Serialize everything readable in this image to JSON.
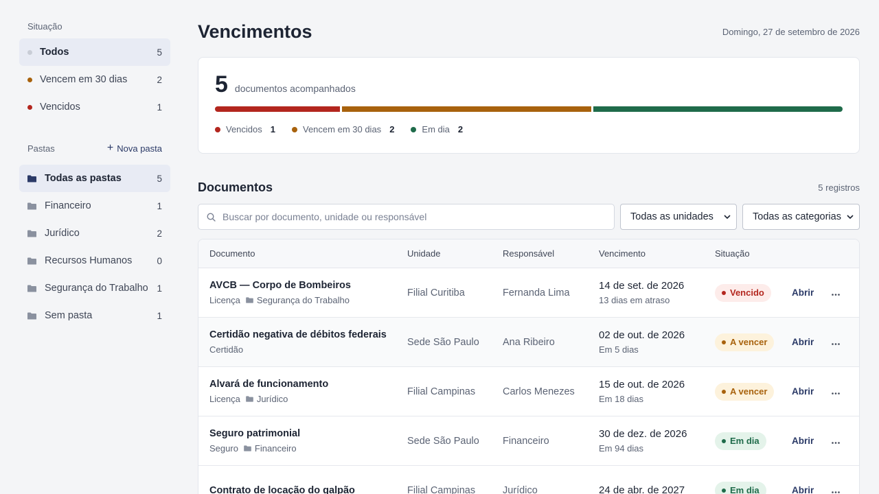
{
  "colors": {
    "overdue": "#b3261e",
    "due_soon": "#a8620d",
    "on_time": "#1f6b4a",
    "neutral": "#c9cdd6",
    "folder": "#8a919f",
    "folder_active": "#2b3a67"
  },
  "sidebar": {
    "status_label": "Situação",
    "status_items": [
      {
        "label": "Todos",
        "count": "5",
        "dot": "#c9cdd6"
      },
      {
        "label": "Vencem em 30 dias",
        "count": "2",
        "dot": "#a8620d"
      },
      {
        "label": "Vencidos",
        "count": "1",
        "dot": "#b3261e"
      }
    ],
    "folders_label": "Pastas",
    "new_folder_label": "Nova pasta",
    "folder_items": [
      {
        "label": "Todas as pastas",
        "count": "5"
      },
      {
        "label": "Financeiro",
        "count": "1"
      },
      {
        "label": "Jurídico",
        "count": "2"
      },
      {
        "label": "Recursos Humanos",
        "count": "0"
      },
      {
        "label": "Segurança do Trabalho",
        "count": "1"
      },
      {
        "label": "Sem pasta",
        "count": "1"
      }
    ]
  },
  "header": {
    "title": "Vencimentos",
    "date": "Domingo, 27 de setembro de 2026"
  },
  "summary": {
    "total": "5",
    "total_label": "documentos acompanhados",
    "breakdown": [
      {
        "label": "Vencidos",
        "value": 1,
        "count": "1",
        "color": "#b3261e"
      },
      {
        "label": "Vencem em 30 dias",
        "value": 2,
        "count": "2",
        "color": "#a8620d"
      },
      {
        "label": "Em dia",
        "value": 2,
        "count": "2",
        "color": "#1f6b4a"
      }
    ]
  },
  "documents": {
    "title": "Documentos",
    "records": "5 registros",
    "search_placeholder": "Buscar por documento, unidade ou responsável",
    "unit_filter": "Todas as unidades",
    "category_filter": "Todas as categorias",
    "columns": [
      "Documento",
      "Unidade",
      "Responsável",
      "Vencimento",
      "Situação"
    ],
    "open_label": "Abrir",
    "rows": [
      {
        "name": "AVCB — Corpo de Bombeiros",
        "type": "Licença",
        "folder": "Segurança do Trabalho",
        "unit": "Filial Curitiba",
        "resp": "Fernanda Lima",
        "due": "14 de set. de 2026",
        "note": "13 dias em atraso",
        "status": "Vencido",
        "status_color": "#b3261e",
        "status_bg": "#fdecea"
      },
      {
        "name": "Certidão negativa de débitos federais",
        "type": "Certidão",
        "folder": "",
        "unit": "Sede São Paulo",
        "resp": "Ana Ribeiro",
        "due": "02 de out. de 2026",
        "note": "Em 5 dias",
        "status": "A vencer",
        "status_color": "#a8620d",
        "status_bg": "#fdf2dc"
      },
      {
        "name": "Alvará de funcionamento",
        "type": "Licença",
        "folder": "Jurídico",
        "unit": "Filial Campinas",
        "resp": "Carlos Menezes",
        "due": "15 de out. de 2026",
        "note": "Em 18 dias",
        "status": "A vencer",
        "status_color": "#a8620d",
        "status_bg": "#fdf2dc"
      },
      {
        "name": "Seguro patrimonial",
        "type": "Seguro",
        "folder": "Financeiro",
        "unit": "Sede São Paulo",
        "resp": "Financeiro",
        "due": "30 de dez. de 2026",
        "note": "Em 94 dias",
        "status": "Em dia",
        "status_color": "#1f6b4a",
        "status_bg": "#e4f3ea"
      },
      {
        "name": "Contrato de locação do galpão",
        "type": "",
        "folder": "",
        "unit": "Filial Campinas",
        "resp": "Jurídico",
        "due": "24 de abr. de 2027",
        "note": "",
        "status": "Em dia",
        "status_color": "#1f6b4a",
        "status_bg": "#e4f3ea"
      }
    ]
  }
}
